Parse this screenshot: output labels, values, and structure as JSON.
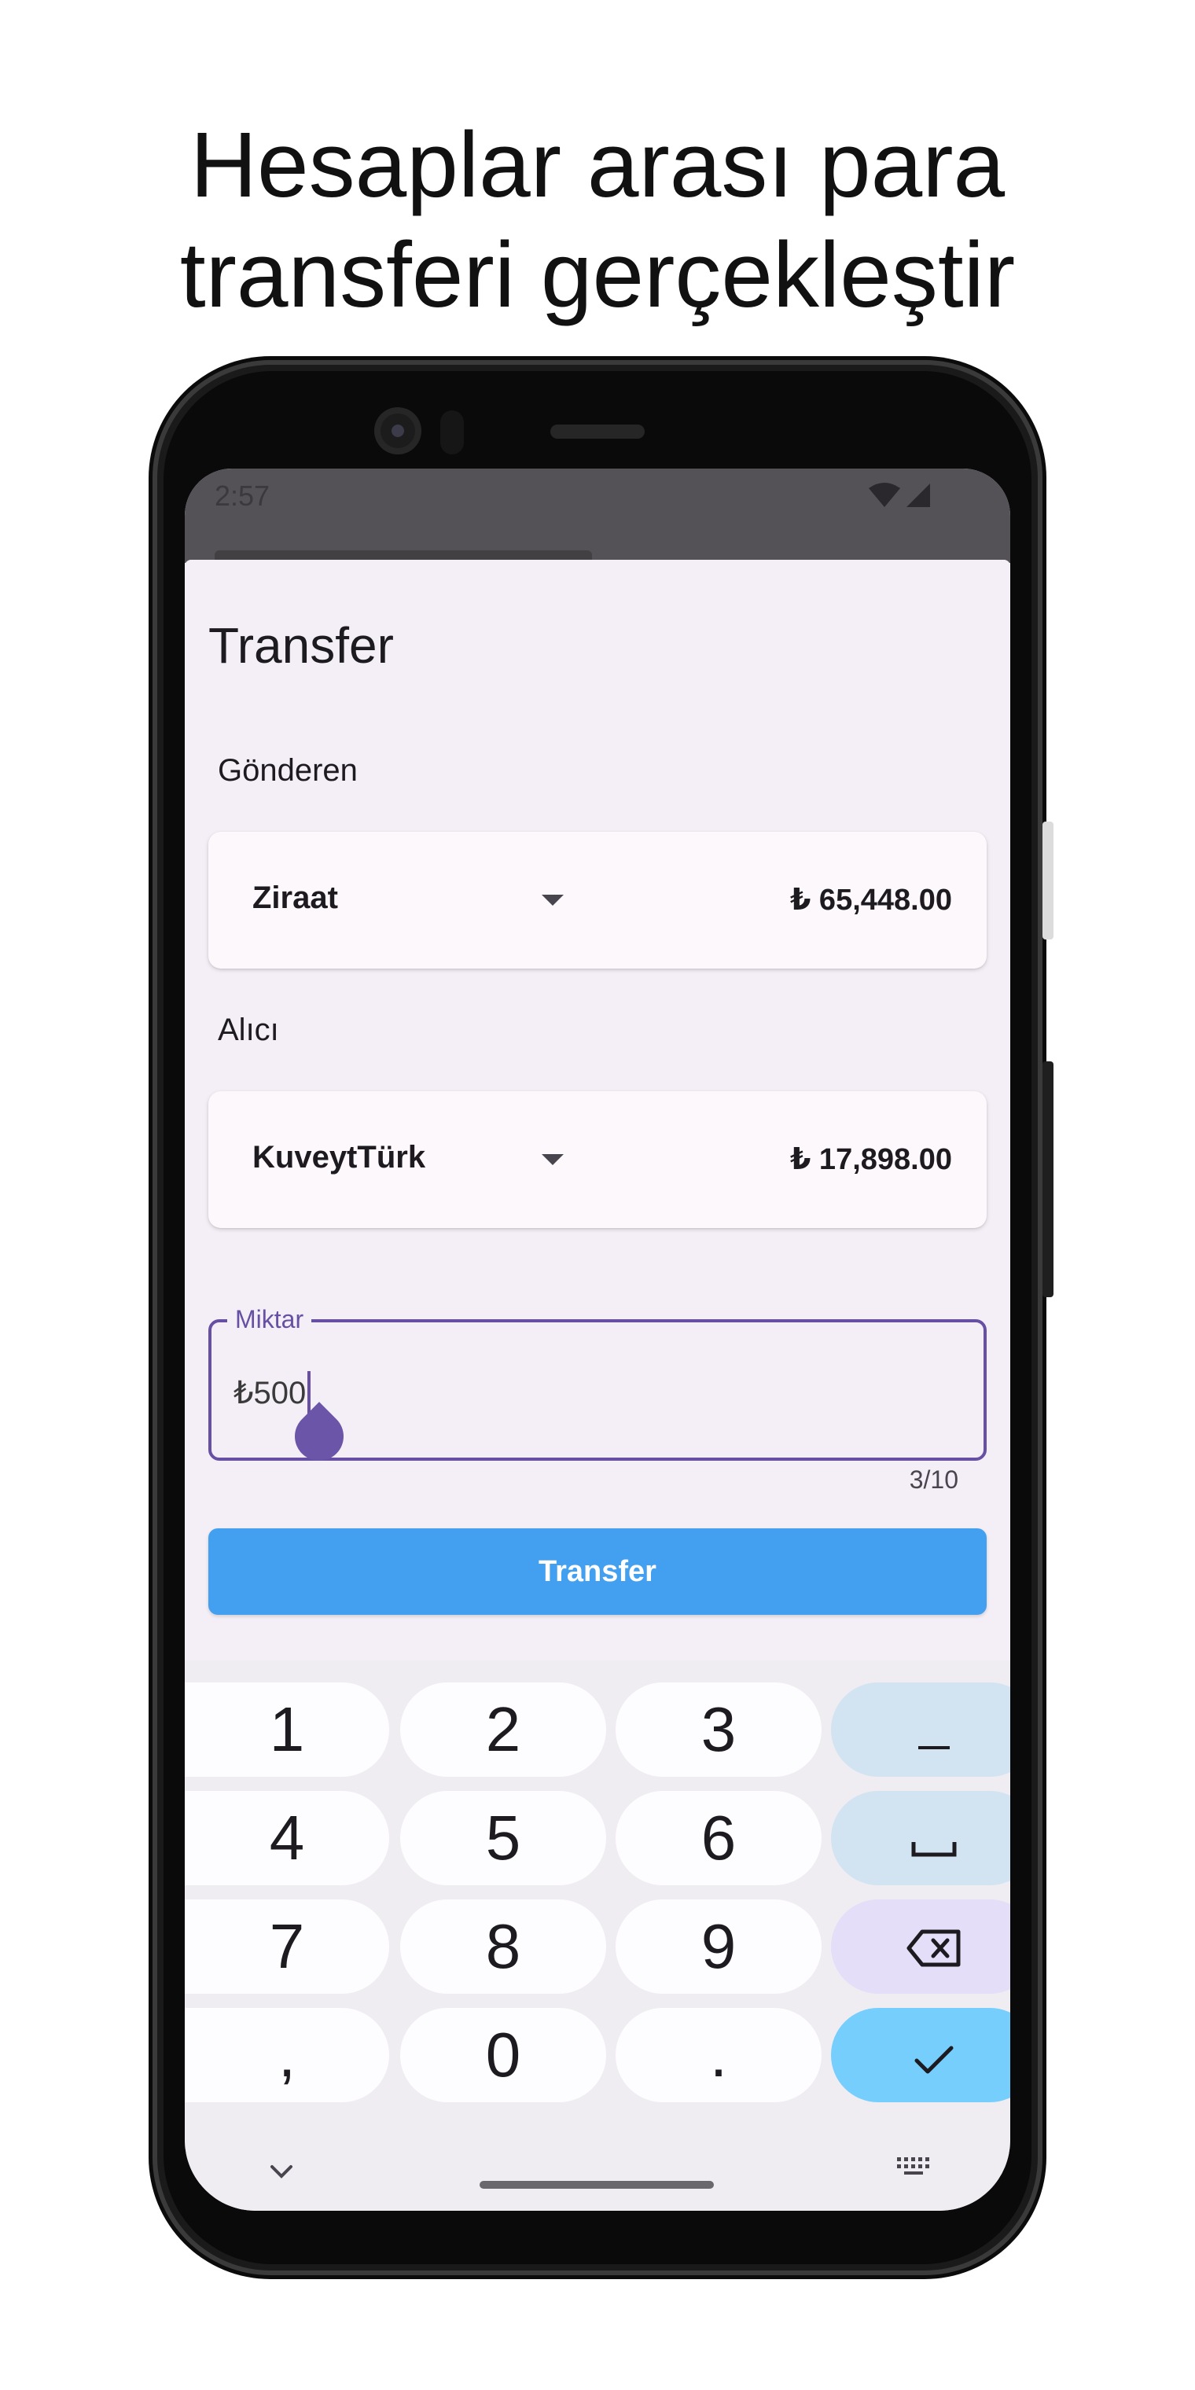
{
  "headline": {
    "line1": "Hesaplar arası para",
    "line2": "transferi gerçekleştir"
  },
  "status_bar": {
    "time": "2:57",
    "icons": [
      "wifi-icon",
      "signal-icon"
    ]
  },
  "dialog": {
    "title": "Transfer",
    "sender_label": "Gönderen",
    "sender": {
      "name": "Ziraat",
      "balance": "₺ 65,448.00"
    },
    "receiver_label": "Alıcı",
    "receiver": {
      "name": "KuveytTürk",
      "balance": "₺ 17,898.00"
    },
    "amount_field": {
      "label": "Miktar",
      "value": "₺500",
      "counter": "3/10"
    },
    "submit_label": "Transfer"
  },
  "keyboard": {
    "keys": [
      "1",
      "2",
      "3",
      "–",
      "4",
      "5",
      "6",
      "␣",
      "7",
      "8",
      "9",
      "⌫",
      ",",
      "0",
      ".",
      "✓"
    ],
    "collapse_icon": "chevron-down-icon",
    "switch_icon": "keyboard-icon"
  },
  "colors": {
    "accent": "#6750a4",
    "button": "#43a0f1",
    "sheet_bg": "#f4eff7",
    "key_fn": "#d2e3f2",
    "key_delete": "#e4def8",
    "key_done": "#76cefd"
  }
}
